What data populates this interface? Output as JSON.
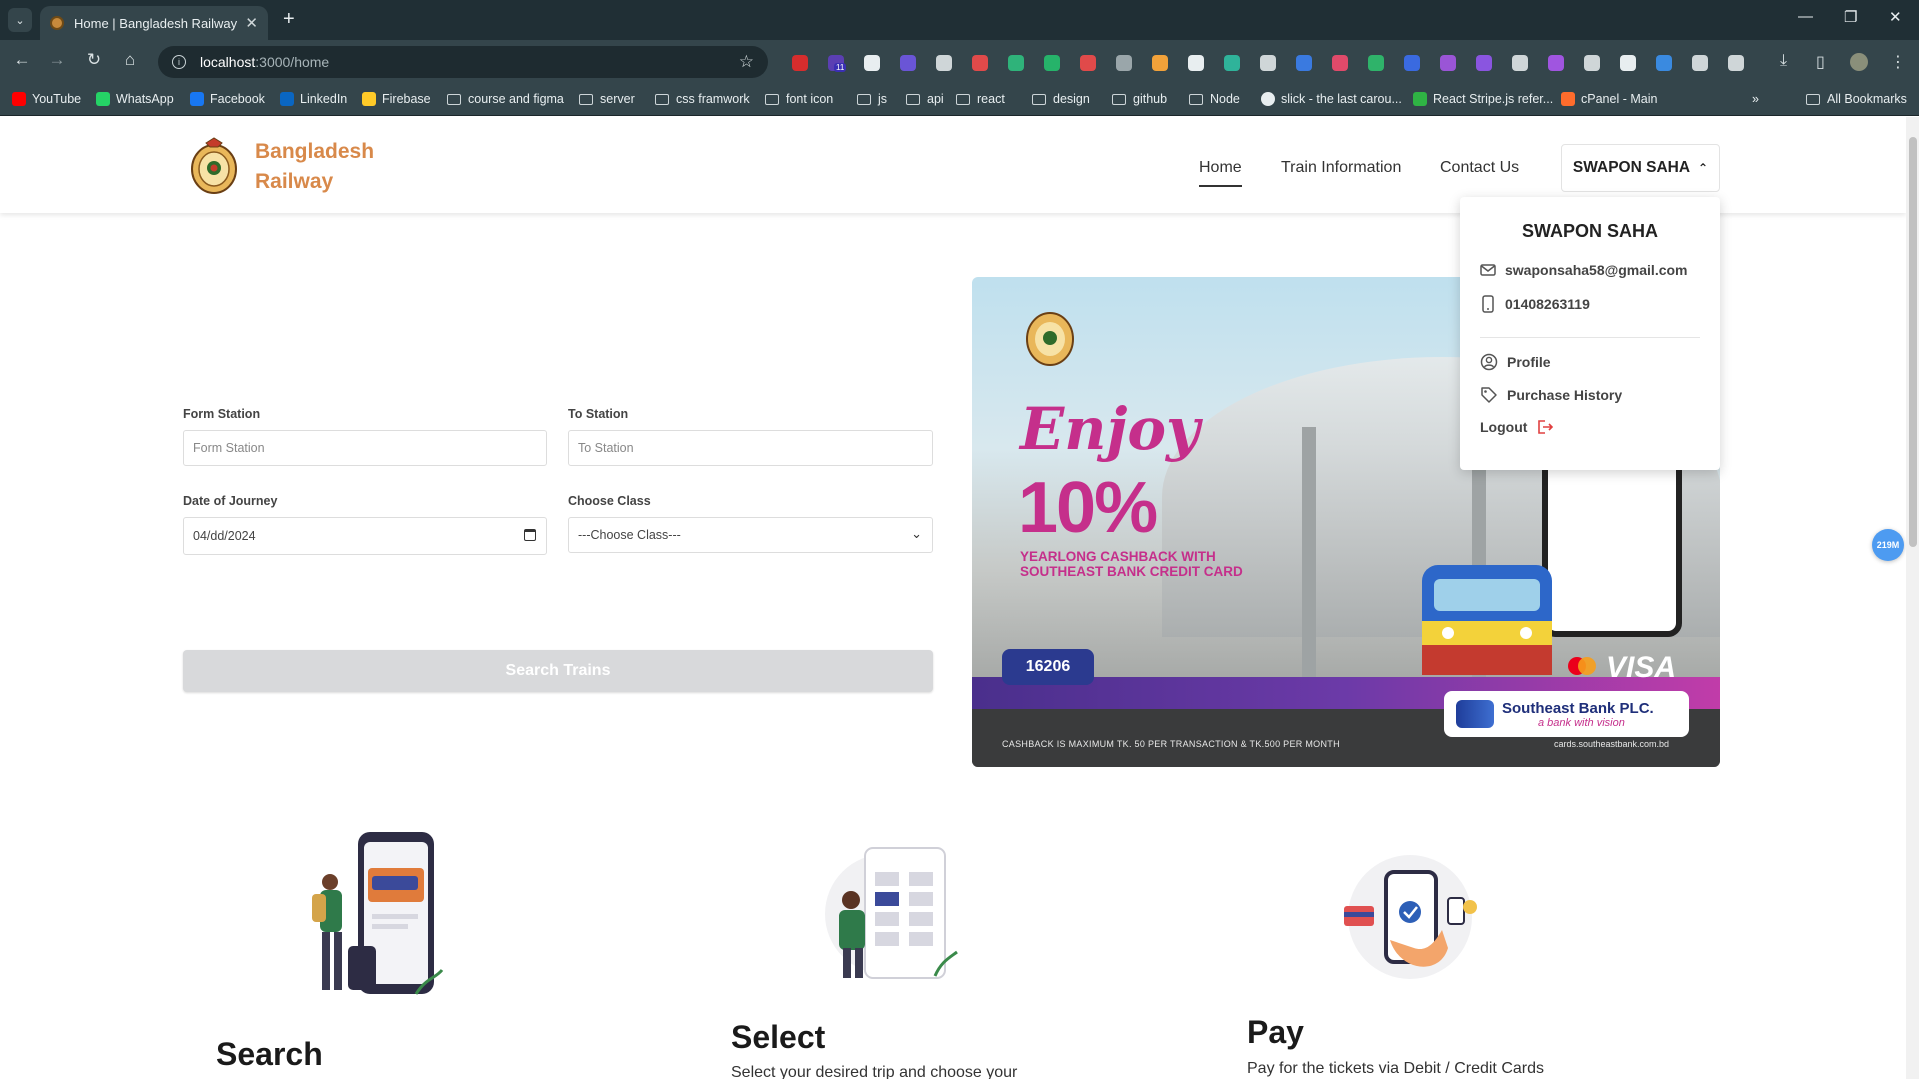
{
  "browser": {
    "tab_title": "Home | Bangladesh Railway",
    "url_host": "localhost",
    "url_path": ":3000/home",
    "bookmarks": [
      {
        "label": "YouTube",
        "icon": "youtube-icon",
        "color": "#ff0000"
      },
      {
        "label": "WhatsApp",
        "icon": "whatsapp-icon",
        "color": "#25d366"
      },
      {
        "label": "Facebook",
        "icon": "facebook-icon",
        "color": "#1877f2"
      },
      {
        "label": "LinkedIn",
        "icon": "linkedin-icon",
        "color": "#0a66c2"
      },
      {
        "label": "Firebase",
        "icon": "firebase-icon",
        "color": "#ffca28"
      },
      {
        "label": "course and figma",
        "icon": "folder-icon"
      },
      {
        "label": "server",
        "icon": "folder-icon"
      },
      {
        "label": "css framwork",
        "icon": "folder-icon"
      },
      {
        "label": "font icon",
        "icon": "folder-icon"
      },
      {
        "label": "js",
        "icon": "folder-icon"
      },
      {
        "label": "api",
        "icon": "folder-icon"
      },
      {
        "label": "react",
        "icon": "folder-icon"
      },
      {
        "label": "design",
        "icon": "folder-icon"
      },
      {
        "label": "github",
        "icon": "folder-icon"
      },
      {
        "label": "Node",
        "icon": "folder-icon"
      },
      {
        "label": "slick - the last carou...",
        "icon": "globe-icon",
        "color": "#e8eef0"
      },
      {
        "label": "React Stripe.js refer...",
        "icon": "stripe-icon",
        "color": "#2fb344"
      },
      {
        "label": "cPanel - Main",
        "icon": "cpanel-icon",
        "color": "#ff6c2c"
      }
    ],
    "all_bookmarks": "All Bookmarks",
    "extension_badge": "11"
  },
  "site": {
    "brand_line1": "Bangladesh",
    "brand_line2": "Railway",
    "nav": {
      "home": "Home",
      "train_info": "Train Information",
      "contact": "Contact Us"
    },
    "user_button": "SWAPON SAHA"
  },
  "dropdown": {
    "name": "SWAPON SAHA",
    "email": "swaponsaha58@gmail.com",
    "phone": "01408263119",
    "profile": "Profile",
    "purchase_history": "Purchase History",
    "logout": "Logout"
  },
  "form": {
    "from_label": "Form Station",
    "from_placeholder": "Form Station",
    "to_label": "To Station",
    "to_placeholder": "To Station",
    "date_label": "Date of Journey",
    "date_value": "04/dd/2024",
    "class_label": "Choose Class",
    "class_value": "---Choose Class---",
    "search_button": "Search Trains"
  },
  "banner": {
    "enjoy": "Enjoy",
    "percent": "10%",
    "cashback_line1": "YEARLONG CASHBACK WITH",
    "cashback_line2": "SOUTHEAST BANK CREDIT CARD",
    "hotline": "16206",
    "bank_name": "Southeast Bank PLC.",
    "bank_tagline": "a bank with vision",
    "card_brand": "VISA",
    "terms": "CASHBACK IS MAXIMUM TK. 50 PER TRANSACTION & TK.500 PER MONTH",
    "site": "cards.southeastbank.com.bd"
  },
  "floating_badge": "219M",
  "steps": [
    {
      "title": "Search",
      "desc": ""
    },
    {
      "title": "Select",
      "desc": "Select your desired trip and choose your"
    },
    {
      "title": "Pay",
      "desc": "Pay for the tickets via Debit / Credit Cards"
    }
  ],
  "colors": {
    "brand": "#d8894a",
    "chrome_dark": "#202f35",
    "chrome": "#34454b",
    "accent_pink": "#c52f8b",
    "badge_blue": "#4d9bf1"
  }
}
